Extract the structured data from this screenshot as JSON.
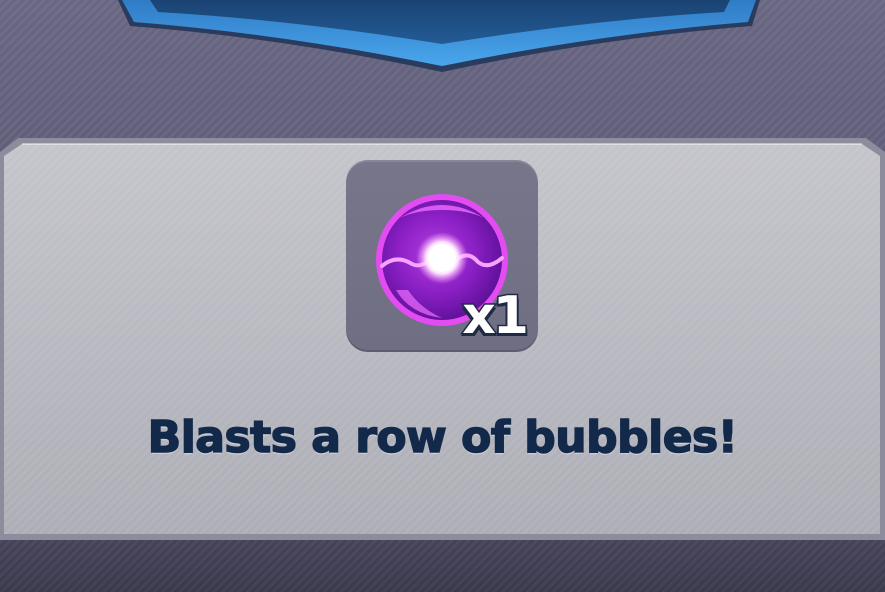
{
  "powerup": {
    "icon": "purple-energy-orb",
    "quantity_label": "x1",
    "description": "Blasts a row of bubbles!"
  },
  "colors": {
    "banner_fill": "#1f4f87",
    "banner_edge": "#3a8fd8",
    "panel_fill": "#b8b8c0",
    "text": "#13294a",
    "orb": "#c03ad8"
  }
}
